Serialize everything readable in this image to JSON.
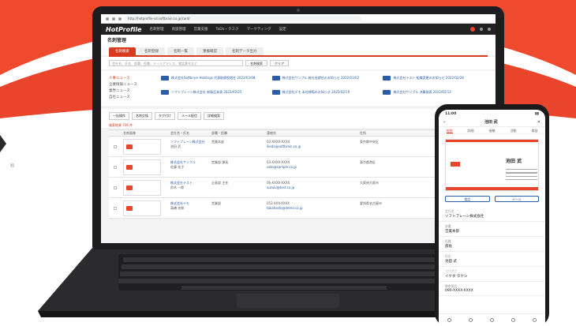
{
  "brand": {
    "accent": "#e8452c",
    "dark": "#1d1d1f"
  },
  "browser": {
    "url": "http://hotprofile-sd.softbrain.co.jp/card/"
  },
  "app": {
    "logo": "HotProfile",
    "nav": [
      "名刺管理",
      "商談管理",
      "営業支援",
      "ToDo・タスク",
      "マーケティング",
      "設定"
    ],
    "page_title": "名刺管理",
    "tabs": [
      "名刺検索",
      "名刺登録",
      "名刺一覧",
      "重複確認",
      "名刺データ出力"
    ],
    "search_placeholder": "会社名、氏名、部署、役職、メールアドレス、電話番号など",
    "search_button": "名刺検索",
    "clear_button": "クリア",
    "news_side": [
      "人事ニュース",
      "企業情報ニュース",
      "業界ニュース",
      "自社ニュース"
    ],
    "news": [
      "株式会社Softbrain Holdings 代表取締役就任 2022/03/08",
      "株式会社サンプル 新社長就任のお知らせ 2022/03/02",
      "株式会社テスト 組織変更のお知らせ 2022/02/28",
      "ソフトブレーン株式会社 新製品発表 2022/02/25",
      "株式会社デモ 本社移転のお知らせ 2022/02/19",
      "株式会社サンプル 決算発表 2022/02/12"
    ],
    "toolbar": [
      "一括操作",
      "名刺交換",
      "タグ付け",
      "メール配信",
      "詳細検索"
    ],
    "count": "検索結果 706 件",
    "headers": [
      "",
      "名刺画像",
      "会社名・氏名",
      "部署・役職",
      "連絡先",
      "住所"
    ],
    "rows": [
      {
        "company": "ソフトブレーン株式会社",
        "name": "池田 武",
        "dept": "営業本部",
        "tel": "03-XXXX-XXXX",
        "mail": "ikeda@softbrain.co.jp",
        "addr": "東京都中央区"
      },
      {
        "company": "株式会社サンプル",
        "name": "佐藤 花子",
        "dept": "営業部 課長",
        "tel": "03-XXXX-XXXX",
        "mail": "sato@sample.co.jp",
        "addr": "東京都港区"
      },
      {
        "company": "株式会社テスト",
        "name": "鈴木 一郎",
        "dept": "企画部 主任",
        "tel": "06-XXXX-XXXX",
        "mail": "suzuki@test.co.jp",
        "addr": "大阪府大阪市"
      },
      {
        "company": "株式会社デモ",
        "name": "高橋 次郎",
        "dept": "営業部",
        "tel": "052-XXX-XXXX",
        "mail": "takahashi@demo.co.jp",
        "addr": "愛知県名古屋市"
      }
    ]
  },
  "phone": {
    "time": "11:00",
    "title": "池田 武",
    "tabs": [
      "名刺",
      "詳細",
      "接触",
      "活動",
      "商談"
    ],
    "card_name": "池田 武",
    "buttons": [
      "電話",
      "メール"
    ],
    "fields": [
      {
        "label": "会社名",
        "value": "ソフトブレーン株式会社"
      },
      {
        "label": "部署",
        "value": "営業本部"
      },
      {
        "label": "役職",
        "value": "部長"
      },
      {
        "label": "氏名",
        "value": "池田 武"
      },
      {
        "label": "フリガナ",
        "value": "イケダ タケシ"
      },
      {
        "label": "携帯電話",
        "value": "090-XXXX-XXXX"
      }
    ]
  }
}
